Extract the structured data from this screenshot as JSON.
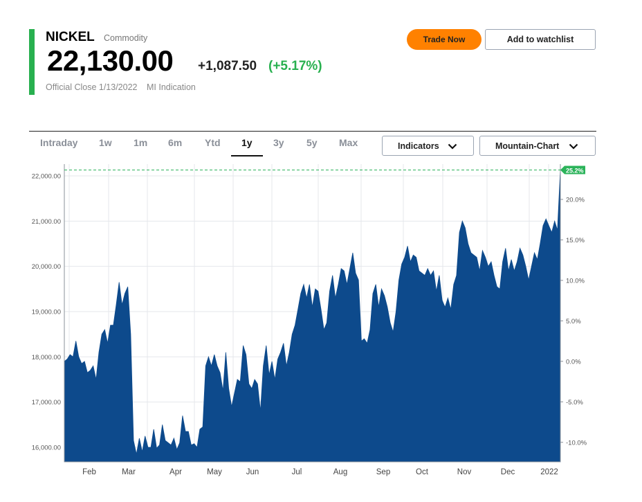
{
  "quote": {
    "name": "NICKEL",
    "type": "Commodity",
    "price": "22,130.00",
    "change": "+1,087.50",
    "change_pct": "(+5.17%)",
    "close_label": "Official Close 1/13/2022",
    "indication": "MI Indication"
  },
  "actions": {
    "trade_now": "Trade Now",
    "watchlist": "Add to watchlist"
  },
  "range_tabs": [
    "Intraday",
    "1w",
    "1m",
    "6m",
    "Ytd",
    "1y",
    "3y",
    "5y",
    "Max"
  ],
  "active_range": "1y",
  "controls": {
    "indicators": "Indicators",
    "chart_type": "Mountain-Chart"
  },
  "colors": {
    "accent": "#28b04f",
    "area": "#0d4a8c",
    "trade": "#ff8100",
    "badge": "#2bb35a"
  },
  "chart_data": {
    "type": "area",
    "title": "",
    "x_tick_labels": [
      "Feb",
      "Mar",
      "Apr",
      "May",
      "Jun",
      "Jul",
      "Aug",
      "Sep",
      "Oct",
      "Nov",
      "Dec",
      "2022"
    ],
    "y_left_ticks": [
      "16,000.00",
      "17,000.00",
      "18,000.00",
      "19,000.00",
      "20,000.00",
      "21,000.00",
      "22,000.00"
    ],
    "y_left_tick_values": [
      16000,
      17000,
      18000,
      19000,
      20000,
      21000,
      22000
    ],
    "y_right_ticks": [
      "-10.0%",
      "-5.0%",
      "0.0%",
      "5.0%",
      "10.0%",
      "15.0%",
      "20.0%"
    ],
    "y_right_tick_values": [
      -10,
      -5,
      0,
      5,
      10,
      15,
      20
    ],
    "ylim": [
      15700,
      22270
    ],
    "last_value_badge": "25.2%",
    "grid": true,
    "series": [
      {
        "values": [
          17900,
          17950,
          18050,
          18000,
          18350,
          18000,
          17850,
          17900,
          17650,
          17700,
          17800,
          17500,
          18100,
          18500,
          18600,
          18300,
          18700,
          18700,
          19150,
          19650,
          19150,
          19400,
          19550,
          18500,
          16150,
          15850,
          16200,
          15900,
          16250,
          16000,
          16000,
          16400,
          15980,
          16050,
          16500,
          16150,
          16100,
          16050,
          16200,
          15950,
          16100,
          16700,
          16350,
          16350,
          16050,
          16080,
          16000,
          16400,
          16450,
          17800,
          18000,
          17800,
          18050,
          17800,
          17650,
          17250,
          18100,
          17300,
          16900,
          17200,
          17500,
          17450,
          18250,
          18050,
          17400,
          17300,
          17500,
          17400,
          16800,
          17800,
          18250,
          17600,
          17900,
          17500,
          17950,
          18100,
          18300,
          17800,
          18100,
          18500,
          18700,
          19050,
          19400,
          19600,
          19300,
          19600,
          19100,
          19500,
          19450,
          19050,
          18600,
          18750,
          19450,
          19800,
          19300,
          19600,
          19950,
          19900,
          19600,
          19950,
          20300,
          19850,
          19700,
          18350,
          18400,
          18300,
          18600,
          19400,
          19600,
          19100,
          19500,
          19350,
          19100,
          18750,
          18550,
          19000,
          19700,
          20050,
          20200,
          20450,
          20100,
          20250,
          20200,
          19900,
          19850,
          19800,
          19950,
          19800,
          19900,
          19450,
          19800,
          19250,
          19100,
          19300,
          19050,
          19600,
          19800,
          20750,
          21000,
          20850,
          20500,
          20300,
          20250,
          20200,
          19900,
          20350,
          20200,
          20000,
          20100,
          19800,
          19550,
          19500,
          20100,
          20400,
          19900,
          20150,
          19900,
          20100,
          20400,
          20250,
          20000,
          19700,
          20000,
          20300,
          20150,
          20500,
          20900,
          21050,
          20900,
          20750,
          21000,
          20800,
          22130
        ]
      }
    ]
  }
}
